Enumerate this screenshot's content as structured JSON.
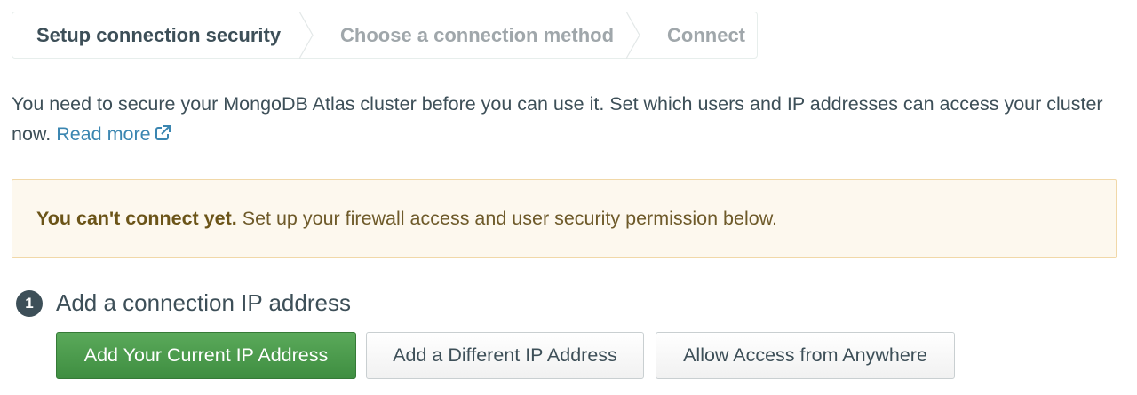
{
  "stepper": {
    "steps": [
      {
        "label": "Setup connection security",
        "active": true
      },
      {
        "label": "Choose a connection method",
        "active": false
      },
      {
        "label": "Connect",
        "active": false
      }
    ]
  },
  "description": {
    "text": "You need to secure your MongoDB Atlas cluster before you can use it. Set which users and IP addresses can access your cluster now.",
    "link_label": "Read more",
    "link_icon": "external-link-icon"
  },
  "banner": {
    "bold_text": "You can't connect yet.",
    "text": "Set up your firewall access and user security permission below."
  },
  "section": {
    "number": "1",
    "title": "Add a connection IP address"
  },
  "buttons": {
    "add_current_ip": "Add Your Current IP Address",
    "add_different_ip": "Add a Different IP Address",
    "allow_anywhere": "Allow Access from Anywhere"
  },
  "colors": {
    "primary_green": "#4a9b4c",
    "link_blue": "#3b86b1",
    "banner_bg": "#fdf8ee",
    "text_dark": "#3d4f58"
  }
}
